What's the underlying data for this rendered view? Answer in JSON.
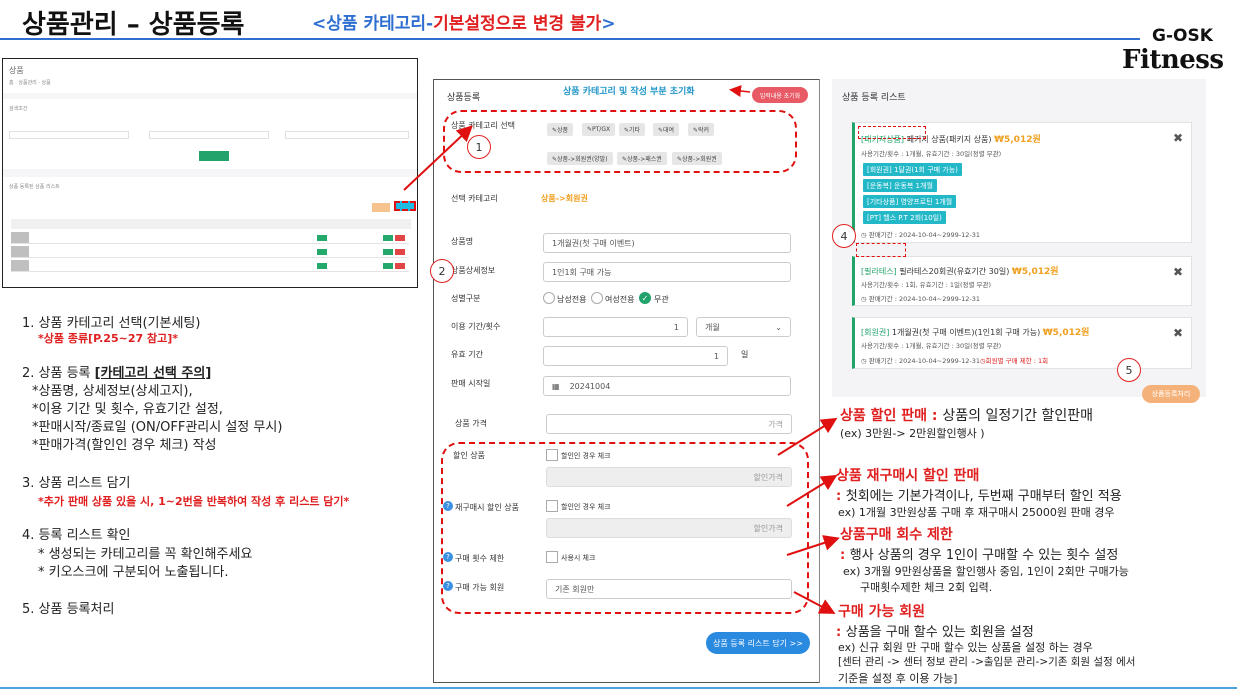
{
  "header": {
    "title": "상품관리 –  상품등록",
    "subtitle_prefix": "<상품 카테고리-",
    "subtitle_red": "기본설정으로 변경 불가",
    "subtitle_suffix": ">",
    "brand_top": "G-OSK",
    "brand_bottom": "Fitness"
  },
  "thumbnail": {
    "title": "상품",
    "breadcrumb": "홈 · 상품관리 · 상품",
    "search_label": "검색조건",
    "list_label": "상품 등록된 상품 리스트"
  },
  "notes": [
    {
      "text": "1. 상품 카테고리 선택(기본세팅)"
    },
    {
      "text": "*상품 종류[P.25~27 참고]*"
    },
    {
      "prefix": "2. 상품 등록 ",
      "underline": "[카테고리 선택 주의]"
    },
    {
      "text": "*상품명, 상세정보(상세고지),"
    },
    {
      "text": "*이용 기간 및 횟수, 유효기간 설정,"
    },
    {
      "text": "*판매시작/종료일 (ON/OFF관리시 설정 무시)"
    },
    {
      "text": "*판매가격(할인인 경우 체크) 작성"
    },
    {
      "text": "3. 상품 리스트 담기"
    },
    {
      "text": "*추가 판매 상품 있을 시, 1~2번을 반복하여 작성 후 리스트 담기*"
    },
    {
      "text": "4. 등록 리스트 확인"
    },
    {
      "text": "* 생성되는 카테고리를 꼭 확인해주세요"
    },
    {
      "text": "* 키오스크에 구분되어 노출됩니다."
    },
    {
      "text": "5. 상품 등록처리"
    }
  ],
  "form": {
    "panel_title": "상품등록",
    "reset_link": "상품 카테고리 및 작성 부분 초기화",
    "reset_button": "입력내용 초기화",
    "category_label": "상품 카테고리 선택",
    "category_chips": [
      "✎상품",
      "✎PT/GX",
      "✎기타",
      "✎대여",
      "✎락커"
    ],
    "category_chips2": [
      "✎상품->회원권(양말)",
      "✎상품->패스권",
      "✎상품->회원권"
    ],
    "selected_category_label": "선택 카테고리",
    "selected_category_value": "상품->회원권",
    "name_label": "상품명",
    "name_value": "1개월권(첫 구매 이벤트)",
    "detail_label": "상품상세정보",
    "detail_value": "1인1회 구매 가능",
    "gender_label": "성별구분",
    "gender_options": [
      "남성전용",
      "여성전용",
      "무관"
    ],
    "period_label": "이용 기간/횟수",
    "period_value": "1",
    "period_unit": "개월",
    "valid_label": "유효 기간",
    "valid_value": "1",
    "valid_unit": "일",
    "start_label": "판매 시작일",
    "start_value": "20241004",
    "price_label": "상품 가격",
    "price_placeholder": "가격",
    "discount_label": "할인 상품",
    "discount_check": "할인인 경우 체크",
    "discount_placeholder": "할인가격",
    "repurchase_label": "재구매시 할인 상품",
    "repurchase_check": "할인인 경우 체크",
    "repurchase_placeholder": "할인가격",
    "limit_label": "구매 횟수 제한",
    "limit_check": "사용시 체크",
    "member_label": "구매 가능 회원",
    "member_value": "기존 회원만",
    "add_button": "상품 등록 리스트 담기 >>",
    "question": "?"
  },
  "list": {
    "title": "상품 등록 리스트",
    "register_button": "상품등록처리",
    "cards": [
      {
        "tag": "[패키지상품]",
        "name": " 패키지 상품(패키지 상품)",
        "price": "₩5,012원",
        "meta1": "사용기간/횟수 : 1개월, 유효기간 : 30일(정렬 무관)",
        "subs": [
          "[회원권] 1달권(1회 구매 가능)",
          "[운동복] 운동복 1개월",
          "[기타상품] 영양프로틴 1개월",
          "[PT] 헬스 P.T 2회(10일)"
        ],
        "meta2": "◷ 판매기간 : 2024-10-04~2999-12-31"
      },
      {
        "tag": "[필라테스]",
        "name": " 필라테스20회권(유효기간 30일)",
        "price": "₩5,012원",
        "meta1": "사용기간/횟수 : 1회, 유효기간 : 1일(정렬 무관)",
        "meta2": "◷ 판매기간 : 2024-10-04~2999-12-31"
      },
      {
        "tag": "[회원권]",
        "name": " 1개월권(첫 구매 이벤트)(1인1회 구매 가능)",
        "price": "₩5,012원",
        "meta1": "사용기간/횟수 : 1개월, 유효기간 : 30일(정렬 무관)",
        "meta2": "◷ 판매기간 : 2024-10-04~2999-12-31",
        "meta2_red": "◷회원별 구매 제한 : 1회"
      }
    ]
  },
  "circles": [
    "1",
    "2",
    "4",
    "5"
  ],
  "annotations": {
    "discount_title": "상품 할인 판매 : ",
    "discount_desc": "상품의 일정기간 할인판매",
    "discount_ex": "(ex) 3만원-> 2만원할인행사 )",
    "repurchase_title": "상품 재구매시 할인 판매",
    "repurchase_desc_red": ": ",
    "repurchase_desc": "첫회에는 기본가격이나, 두번째 구매부터 할인 적용",
    "repurchase_ex": "ex) 1개월 3만원상품 구매 후 재구매시 25000원 판매 경우",
    "limit_title": "상품구매 회수 제한",
    "limit_desc_red": ": ",
    "limit_desc": "행사 상품의 경우 1인이 구매할 수 있는 횟수 설정",
    "limit_ex1": "ex) 3개월 9만원상품을 할인행사 중임, 1인이 2회만 구매가능",
    "limit_ex2": "구매횟수제한 체크 2회 입력.",
    "member_title": "구매 가능 회원",
    "member_desc_red": ": ",
    "member_desc": "상품을 구매 할수 있는 회원을 설정",
    "member_ex1": "ex) 신규 회원 만 구매 할수 있는 상품을 설정 하는 경우",
    "member_ex2": "[센터 관리 -> 센터 정보 관리 ->출입문 관리->기존 회원 설정 에서",
    "member_ex3": "기준을 설정 후 이용 가능]"
  },
  "colors": {
    "accent_blue": "#2e6fd0",
    "alert_red": "#e02020",
    "green": "#22a36b",
    "cyan": "#22b8c8",
    "orange": "#f0a020"
  }
}
